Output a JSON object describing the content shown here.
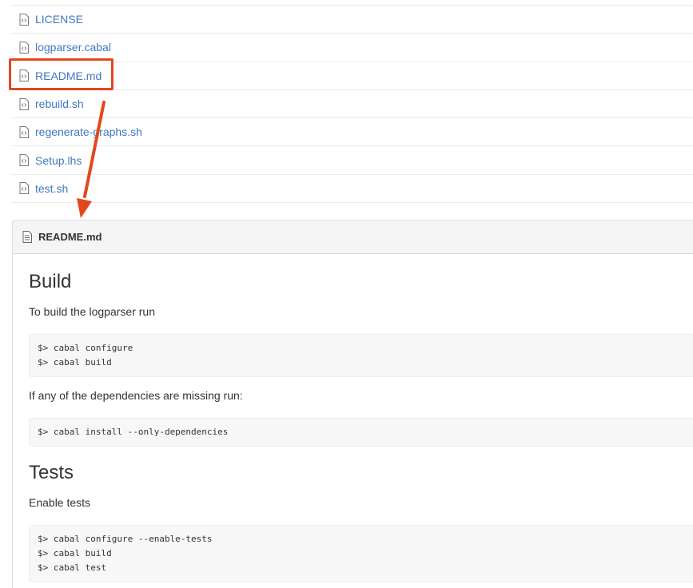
{
  "files": [
    {
      "name": "LICENSE"
    },
    {
      "name": "logparser.cabal"
    },
    {
      "name": "README.md"
    },
    {
      "name": "rebuild.sh"
    },
    {
      "name": "regenerate-graphs.sh"
    },
    {
      "name": "Setup.lhs"
    },
    {
      "name": "test.sh"
    }
  ],
  "annotation": {
    "color": "#e2481e",
    "icon": "arrow-icon"
  },
  "readme": {
    "title": "README.md",
    "icon": "book-icon",
    "build_heading": "Build",
    "build_text": "To build the logparser run",
    "build_code": [
      "$> cabal configure",
      "$> cabal build"
    ],
    "missing_text": "If any of the dependencies are missing run:",
    "install_code": [
      "$> cabal install --only-dependencies"
    ],
    "tests_heading": "Tests",
    "tests_text": "Enable tests",
    "tests_code": [
      "$> cabal configure --enable-tests",
      "$> cabal build",
      "$> cabal test"
    ]
  },
  "colors": {
    "link": "#4078c0",
    "accent": "#e2481e"
  }
}
